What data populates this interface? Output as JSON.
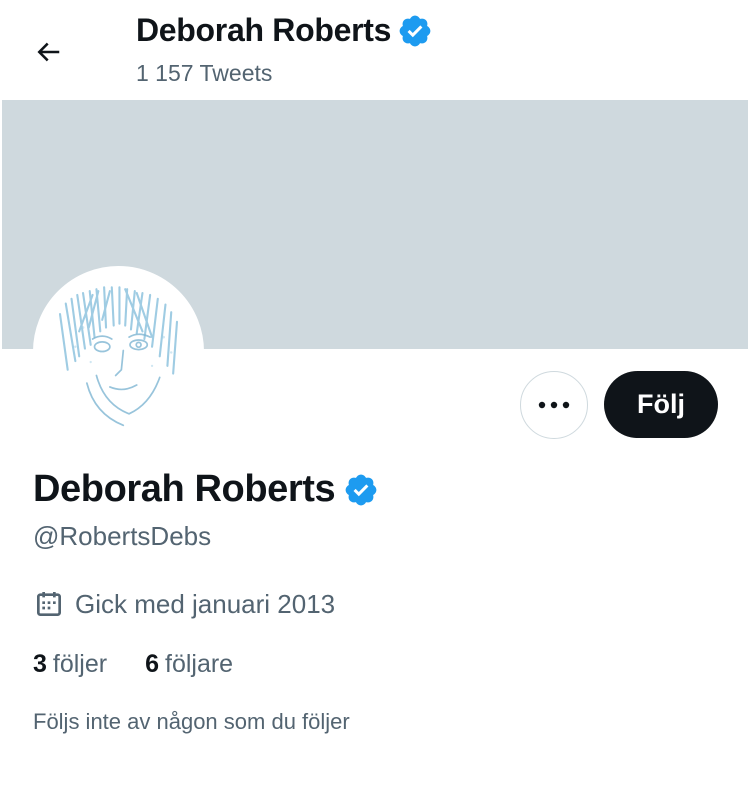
{
  "header": {
    "name": "Deborah Roberts",
    "tweet_count": "1 157 Tweets"
  },
  "profile": {
    "display_name": "Deborah Roberts",
    "handle": "@RobertsDebs",
    "joined": "Gick med januari 2013",
    "following_count": "3",
    "following_label": "följer",
    "followers_count": "6",
    "followers_label": "följare",
    "social_context": "Följs inte av någon som du följer"
  },
  "actions": {
    "follow_label": "Följ"
  },
  "icons": {
    "back": "arrow-left-icon",
    "verified": "verified-badge-icon",
    "more": "more-dots-icon",
    "calendar": "calendar-icon"
  },
  "colors": {
    "banner": "#cfd9de",
    "verified": "#1d9bf0",
    "follow_button": "#0f1419",
    "secondary_text": "#536471"
  }
}
